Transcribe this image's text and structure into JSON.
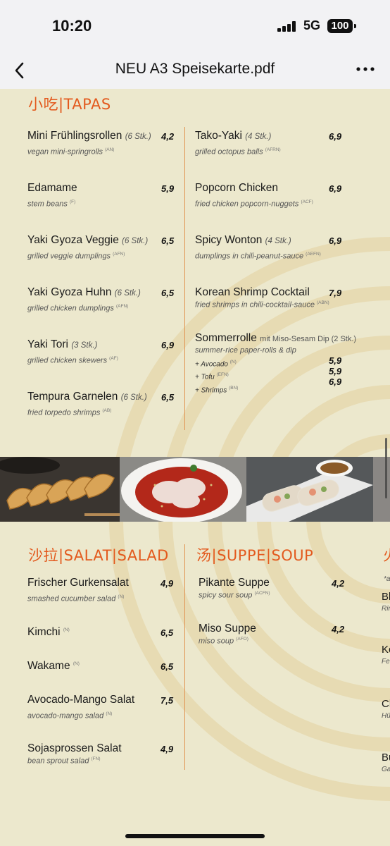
{
  "status": {
    "time": "10:20",
    "network": "5G",
    "battery": "100"
  },
  "header": {
    "title": "NEU A3 Speisekarte.pdf"
  },
  "tapas": {
    "title": "小吃|TAPAS",
    "left": [
      {
        "name": "Mini Frühlingsrollen",
        "qty": "(6 Stk.)",
        "desc": "vegan mini-springrolls",
        "allergens": "(AN)",
        "price": "4,2"
      },
      {
        "name": "Edamame",
        "qty": "",
        "desc": "stem beans",
        "allergens": "(F)",
        "price": "5,9"
      },
      {
        "name": "Yaki Gyoza Veggie",
        "qty": "(6 Stk.)",
        "desc": "grilled veggie dumplings",
        "allergens": "(AFN)",
        "price": "6,5"
      },
      {
        "name": "Yaki Gyoza Huhn",
        "qty": "(6 Stk.)",
        "desc": "grilled chicken dumplings",
        "allergens": "(AFN)",
        "price": "6,5"
      },
      {
        "name": "Yaki Tori",
        "qty": "(3 Stk.)",
        "desc": "grilled chicken skewers",
        "allergens": "(AF)",
        "price": "6,9"
      },
      {
        "name": "Tempura Garnelen",
        "qty": "(6 Stk.)",
        "desc": "fried torpedo shrimps",
        "allergens": "(AB)",
        "price": "6,5"
      }
    ],
    "right": [
      {
        "name": "Tako-Yaki",
        "qty": "(4 Stk.)",
        "desc": "grilled octopus balls",
        "allergens": "(AFRN)",
        "price": "6,9"
      },
      {
        "name": "Popcorn Chicken",
        "qty": "",
        "desc": "fried chicken popcorn-nuggets",
        "allergens": "(ACF)",
        "price": "6,9"
      },
      {
        "name": "Spicy Wonton",
        "qty": "(4 Stk.)",
        "desc": "dumplings in chili-peanut-sauce",
        "allergens": "(AEFN)",
        "price": "6,9"
      },
      {
        "name": "Korean Shrimp Cocktail",
        "qty": "",
        "desc": "fried shrimps in chili-cocktail-sauce",
        "allergens": "(ABN)",
        "price": "7,9"
      }
    ],
    "sommerrolle": {
      "name": "Sommerrolle",
      "qty": "mit Miso-Sesam Dip  (2 Stk.)",
      "desc": "summer-rice paper-rolls & dip",
      "options": [
        {
          "label": "+ Avocado",
          "allergens": "(N)",
          "price": "5,9"
        },
        {
          "label": "+ Tofu",
          "allergens": "(EFN)",
          "price": "5,9"
        },
        {
          "label": "+ Shrimps",
          "allergens": "(BN)",
          "price": "6,9"
        }
      ]
    }
  },
  "salat": {
    "title": "沙拉|SALAT|SALAD",
    "items": [
      {
        "name": "Frischer Gurkensalat",
        "desc": "smashed cucumber salad",
        "allergens": "(N)",
        "price": "4,9"
      },
      {
        "name": "Kimchi",
        "desc": "",
        "allergens": "(N)",
        "price": "6,5"
      },
      {
        "name": "Wakame",
        "desc": "",
        "allergens": "(N)",
        "price": "6,5"
      },
      {
        "name": "Avocado-Mango Salat",
        "desc": "avocado-mango salad",
        "allergens": "(N)",
        "price": "7,5"
      },
      {
        "name": "Sojasprossen Salat",
        "desc": "bean sprout salad",
        "allergens": "(FN)",
        "price": "4,9"
      }
    ]
  },
  "suppe": {
    "title": "汤|SUPPE|SOUP",
    "items": [
      {
        "name": "Pikante Suppe",
        "desc": "spicy sour soup",
        "allergens": "(ACFN)",
        "price": "4,2"
      },
      {
        "name": "Miso Suppe",
        "desc": "miso soup",
        "allergens": "(AFO)",
        "price": "4,2"
      }
    ]
  },
  "edge_column": {
    "title_glyph": "火",
    "small_mark": "*a",
    "items": [
      {
        "name": "Bl",
        "desc": "Rin"
      },
      {
        "name": "Ko",
        "desc": "Fe"
      },
      {
        "name": "Cl",
        "desc": "Hü"
      },
      {
        "name": "Bu",
        "desc": "Ga"
      }
    ]
  },
  "colors": {
    "accent": "#e35a1e",
    "paper": "#ece8cd",
    "divider": "#e0924f"
  },
  "icons": [
    "back-chevron-icon",
    "more-icon",
    "signal-icon",
    "battery-icon"
  ]
}
